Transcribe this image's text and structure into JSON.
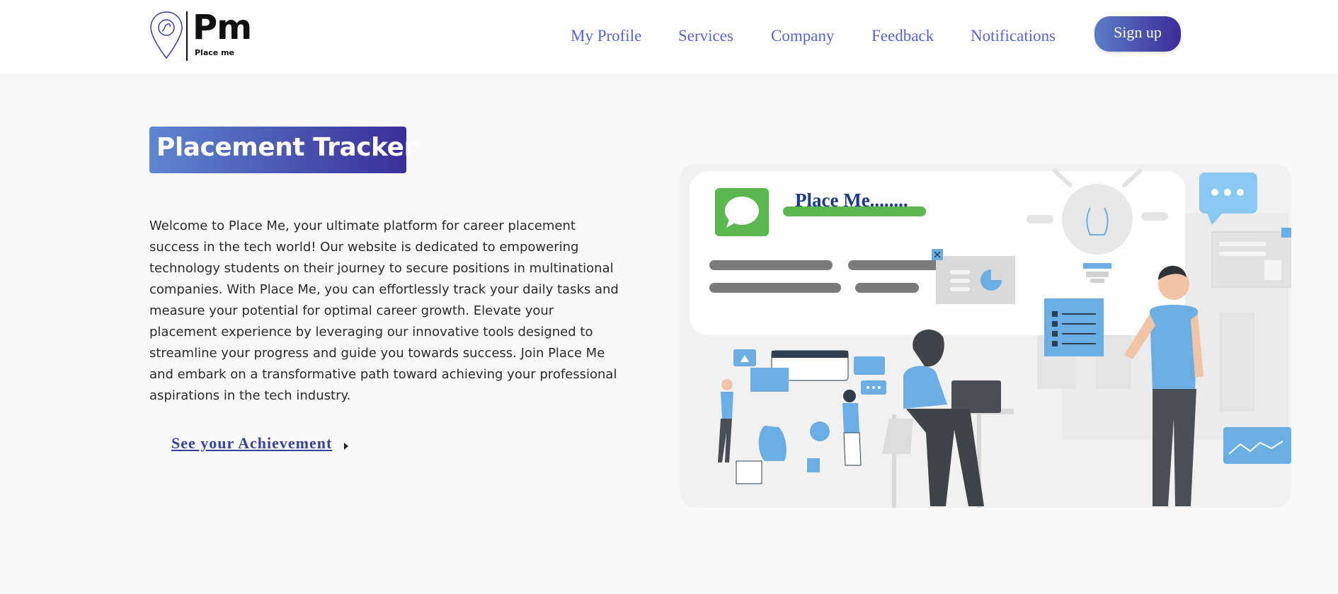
{
  "header": {
    "logo": {
      "mark_text": "Pm",
      "sub_text": "Place me",
      "icon": "location-pin-icon"
    },
    "nav": [
      {
        "label": "My Profile"
      },
      {
        "label": "Services"
      },
      {
        "label": "Company"
      },
      {
        "label": "Feedback"
      },
      {
        "label": "Notifications"
      }
    ],
    "signup_label": "Sign up"
  },
  "hero": {
    "badge_title": "Placement Tracker",
    "description": "Welcome to Place Me, your ultimate platform for career placement success in the tech world! Our website is dedicated to empowering technology students on their journey to secure positions in multinational companies. With Place Me, you can effortlessly track your daily tasks and measure your potential for optimal career growth. Elevate your placement experience by leveraging our innovative tools designed to streamline your progress and guide you towards success. Join Place Me and embark on a transformative path toward achieving your professional aspirations in the tech industry.",
    "link_label": "See your Achievement"
  },
  "illustration": {
    "card_title": "Place Me........",
    "icons": [
      "chat-bubble-icon",
      "lightbulb-icon",
      "speech-dots-icon",
      "pie-chart-icon",
      "close-icon"
    ]
  },
  "colors": {
    "accent_blue": "#5a64cf",
    "gradient_start": "#5e86cf",
    "gradient_end": "#3a2f99",
    "link_color": "#37429f",
    "illustration_blue": "#6aaee3",
    "illustration_green": "#5bb84e"
  }
}
